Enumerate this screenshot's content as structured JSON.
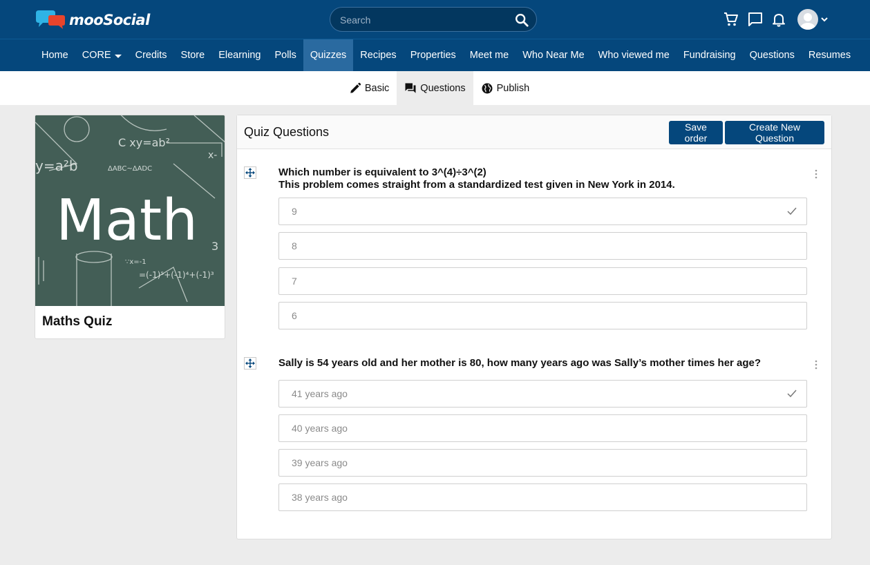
{
  "brand": {
    "name": "mooSocial"
  },
  "search": {
    "placeholder": "Search"
  },
  "header_icons": [
    "cart-icon",
    "chat-icon",
    "bell-icon",
    "avatar"
  ],
  "nav": {
    "items": [
      {
        "label": "Home"
      },
      {
        "label": "CORE",
        "has_dropdown": true
      },
      {
        "label": "Credits"
      },
      {
        "label": "Store"
      },
      {
        "label": "Elearning"
      },
      {
        "label": "Polls"
      },
      {
        "label": "Quizzes",
        "active": true
      },
      {
        "label": "Recipes"
      },
      {
        "label": "Properties"
      },
      {
        "label": "Meet me"
      },
      {
        "label": "Who Near Me"
      },
      {
        "label": "Who viewed me"
      },
      {
        "label": "Fundraising"
      },
      {
        "label": "Questions"
      },
      {
        "label": "Resumes"
      }
    ]
  },
  "subnav": {
    "items": [
      {
        "label": "Basic",
        "icon": "pencil-icon"
      },
      {
        "label": "Questions",
        "icon": "chat-bubbles-icon",
        "active": true
      },
      {
        "label": "Publish",
        "icon": "globe-icon"
      }
    ]
  },
  "quiz": {
    "title": "Maths Quiz",
    "thumbnail_text": "Math"
  },
  "panel": {
    "title": "Quiz Questions",
    "save_label": "Save order",
    "create_label": "Create New Question"
  },
  "questions": [
    {
      "line1": "Which number is equivalent to 3^(4)÷3^(2)",
      "line2": "This problem comes straight from a standardized test given in New York in 2014.",
      "answers": [
        {
          "text": "9",
          "correct": true
        },
        {
          "text": "8",
          "correct": false
        },
        {
          "text": "7",
          "correct": false
        },
        {
          "text": "6",
          "correct": false
        }
      ]
    },
    {
      "line1": "Sally is 54 years old and her mother is 80, how many years ago was Sally’s mother times her age?",
      "line2": "",
      "answers": [
        {
          "text": "41 years ago",
          "correct": true
        },
        {
          "text": "40 years ago",
          "correct": false
        },
        {
          "text": "39 years ago",
          "correct": false
        },
        {
          "text": "38 years ago",
          "correct": false
        }
      ]
    }
  ],
  "colors": {
    "brand": "#05477c",
    "nav_active": "#2a6aa0",
    "page_bg": "#ececec"
  }
}
